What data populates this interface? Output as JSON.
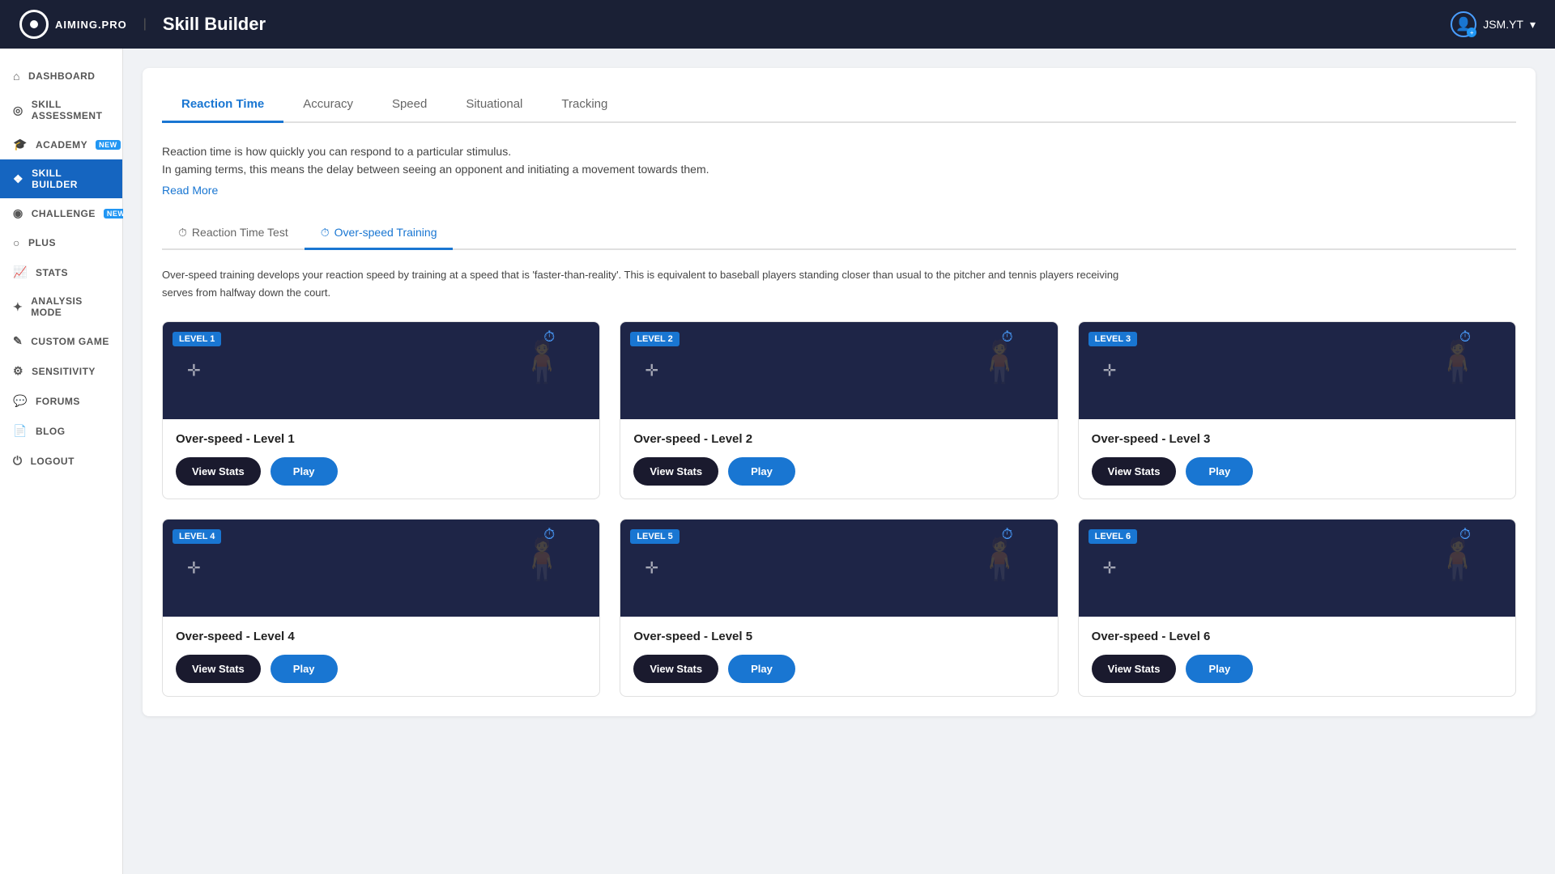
{
  "header": {
    "brand": "AIMING.PRO",
    "title": "Skill Builder",
    "user": "JSM.YT"
  },
  "sidebar": {
    "items": [
      {
        "id": "dashboard",
        "label": "DASHBOARD",
        "icon": "⌂"
      },
      {
        "id": "skill-assessment",
        "label": "SKILL ASSESSMENT",
        "icon": "◎"
      },
      {
        "id": "academy",
        "label": "ACADEMY",
        "icon": "🎓",
        "badge": "NEW"
      },
      {
        "id": "skill-builder",
        "label": "SKILL BUILDER",
        "icon": "❖",
        "active": true
      },
      {
        "id": "challenge",
        "label": "CHALLENGE",
        "icon": "◉",
        "badge": "NEW"
      },
      {
        "id": "plus",
        "label": "PLUS",
        "icon": "○"
      },
      {
        "id": "stats",
        "label": "STATS",
        "icon": "📈"
      },
      {
        "id": "analysis-mode",
        "label": "ANALYSIS MODE",
        "icon": "✦"
      },
      {
        "id": "custom-game",
        "label": "CUSTOM GAME",
        "icon": "✎"
      },
      {
        "id": "sensitivity",
        "label": "SENSITIVITY",
        "icon": "⚙"
      },
      {
        "id": "forums",
        "label": "FORUMS",
        "icon": "💬"
      },
      {
        "id": "blog",
        "label": "BLOG",
        "icon": "📄"
      },
      {
        "id": "logout",
        "label": "LOGOUT",
        "icon": "⏻"
      }
    ]
  },
  "tabs": [
    {
      "id": "reaction-time",
      "label": "Reaction Time",
      "active": true
    },
    {
      "id": "accuracy",
      "label": "Accuracy"
    },
    {
      "id": "speed",
      "label": "Speed"
    },
    {
      "id": "situational",
      "label": "Situational"
    },
    {
      "id": "tracking",
      "label": "Tracking"
    }
  ],
  "description": {
    "line1": "Reaction time is how quickly you can respond to a particular stimulus.",
    "line2": "In gaming terms, this means the delay between seeing an opponent and initiating a movement towards them.",
    "read_more": "Read More"
  },
  "sub_tabs": [
    {
      "id": "reaction-time-test",
      "label": "Reaction Time Test",
      "icon": "⏱"
    },
    {
      "id": "over-speed-training",
      "label": "Over-speed Training",
      "icon": "⏱",
      "active": true
    }
  ],
  "overspeed_description": "Over-speed training develops your reaction speed by training at a speed that is 'faster-than-reality'. This is equivalent to baseball players standing closer than usual to the pitcher and tennis players receiving serves from halfway down the court.",
  "levels": [
    {
      "id": 1,
      "badge": "LEVEL 1",
      "title": "Over-speed - Level 1",
      "view_stats": "View Stats",
      "play": "Play"
    },
    {
      "id": 2,
      "badge": "LEVEL 2",
      "title": "Over-speed - Level 2",
      "view_stats": "View Stats",
      "play": "Play"
    },
    {
      "id": 3,
      "badge": "LEVEL 3",
      "title": "Over-speed - Level 3",
      "view_stats": "View Stats",
      "play": "Play"
    },
    {
      "id": 4,
      "badge": "LEVEL 4",
      "title": "Over-speed - Level 4",
      "view_stats": "View Stats",
      "play": "Play"
    },
    {
      "id": 5,
      "badge": "LEVEL 5",
      "title": "Over-speed - Level 5",
      "view_stats": "View Stats",
      "play": "Play"
    },
    {
      "id": 6,
      "badge": "LEVEL 6",
      "title": "Over-speed - Level 6",
      "view_stats": "View Stats",
      "play": "Play"
    }
  ]
}
